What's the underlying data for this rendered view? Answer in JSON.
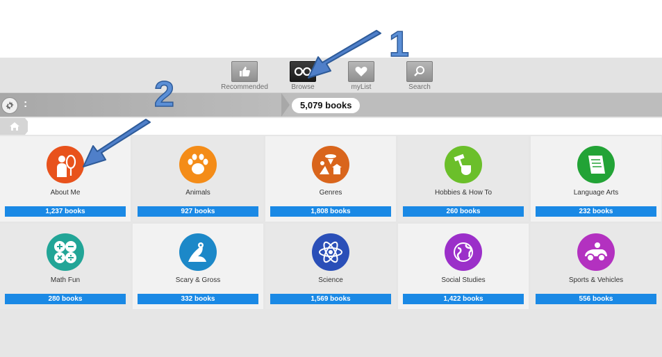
{
  "topnav": {
    "items": [
      {
        "label": "Recommended",
        "icon": "thumbs-up-icon",
        "active": false
      },
      {
        "label": "Browse",
        "icon": "binoculars-icon",
        "active": true
      },
      {
        "label": "myList",
        "icon": "heart-icon",
        "active": false
      },
      {
        "label": "Search",
        "icon": "search-icon",
        "active": false
      }
    ]
  },
  "toolbar": {
    "book_count": "5,079 books",
    "menu_dots": ":"
  },
  "categories": [
    {
      "name": "About Me",
      "count": "1,237 books",
      "color": "#e8521c",
      "icon": "person-mirror-icon"
    },
    {
      "name": "Animals",
      "count": "927 books",
      "color": "#f48c18",
      "icon": "paw-icon"
    },
    {
      "name": "Genres",
      "count": "1,808 books",
      "color": "#d9651c",
      "icon": "genres-collage-icon"
    },
    {
      "name": "Hobbies & How To",
      "count": "260 books",
      "color": "#6bbf2a",
      "icon": "hammer-fist-icon"
    },
    {
      "name": "Language Arts",
      "count": "232 books",
      "color": "#22a336",
      "icon": "scroll-icon"
    },
    {
      "name": "Math Fun",
      "count": "280 books",
      "color": "#22a597",
      "icon": "math-symbols-icon"
    },
    {
      "name": "Scary & Gross",
      "count": "332 books",
      "color": "#1c88c8",
      "icon": "monster-icon"
    },
    {
      "name": "Science",
      "count": "1,569 books",
      "color": "#2a4fb8",
      "icon": "atom-icon"
    },
    {
      "name": "Social Studies",
      "count": "1,422 books",
      "color": "#9b2fc9",
      "icon": "globe-icon"
    },
    {
      "name": "Sports & Vehicles",
      "count": "556 books",
      "color": "#b331c0",
      "icon": "vehicle-icon"
    }
  ],
  "annotations": {
    "one": "1",
    "two": "2"
  }
}
